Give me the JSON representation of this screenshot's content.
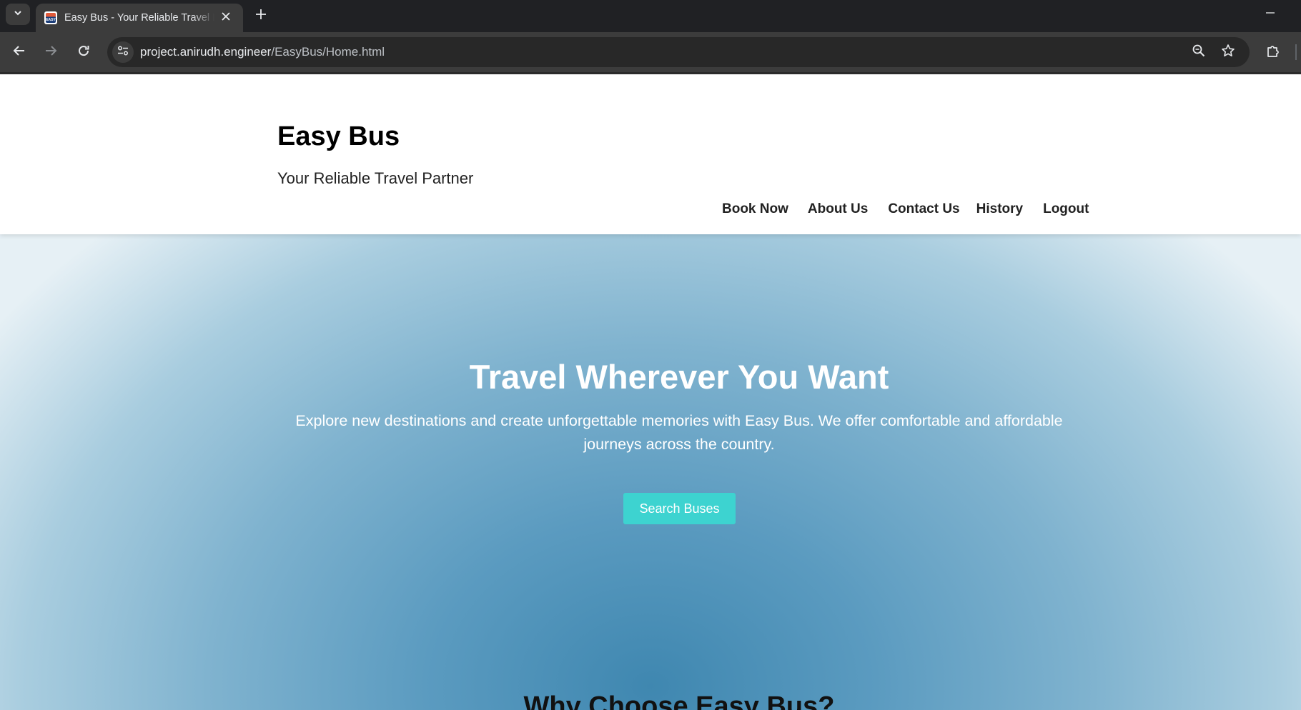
{
  "browser": {
    "tab_title": "Easy Bus - Your Reliable Travel Partner",
    "favicon_text": "EASY",
    "url_host": "project.anirudh.engineer",
    "url_path": "/EasyBus/Home.html"
  },
  "icons": {
    "tab_menu": "chevron-down-icon",
    "tab_close": "close-icon",
    "new_tab": "plus-icon",
    "minimize": "minimize-icon",
    "back": "arrow-left-icon",
    "forward": "arrow-right-icon",
    "reload": "reload-icon",
    "site_info": "tune-icon",
    "zoom": "zoom-icon",
    "bookmark": "star-icon",
    "extensions": "puzzle-icon"
  },
  "header": {
    "title": "Easy Bus",
    "tagline": "Your Reliable Travel Partner",
    "nav": [
      {
        "label": "Book Now"
      },
      {
        "label": "About Us"
      },
      {
        "label": "Contact Us"
      },
      {
        "label": "History"
      },
      {
        "label": "Logout"
      }
    ]
  },
  "hero": {
    "title": "Travel Wherever You Want",
    "text": "Explore new destinations and create unforgettable memories with Easy Bus. We offer comfortable and affordable journeys across the country.",
    "button_label": "Search Buses"
  },
  "sections": {
    "why_title": "Why Choose Easy Bus?"
  },
  "colors": {
    "accent_button": "#3dd3d0",
    "hero_center": "#3f87b0",
    "hero_edge": "#e6f0f5",
    "chrome_dark": "#202124",
    "chrome_toolbar": "#3c3c3c"
  }
}
